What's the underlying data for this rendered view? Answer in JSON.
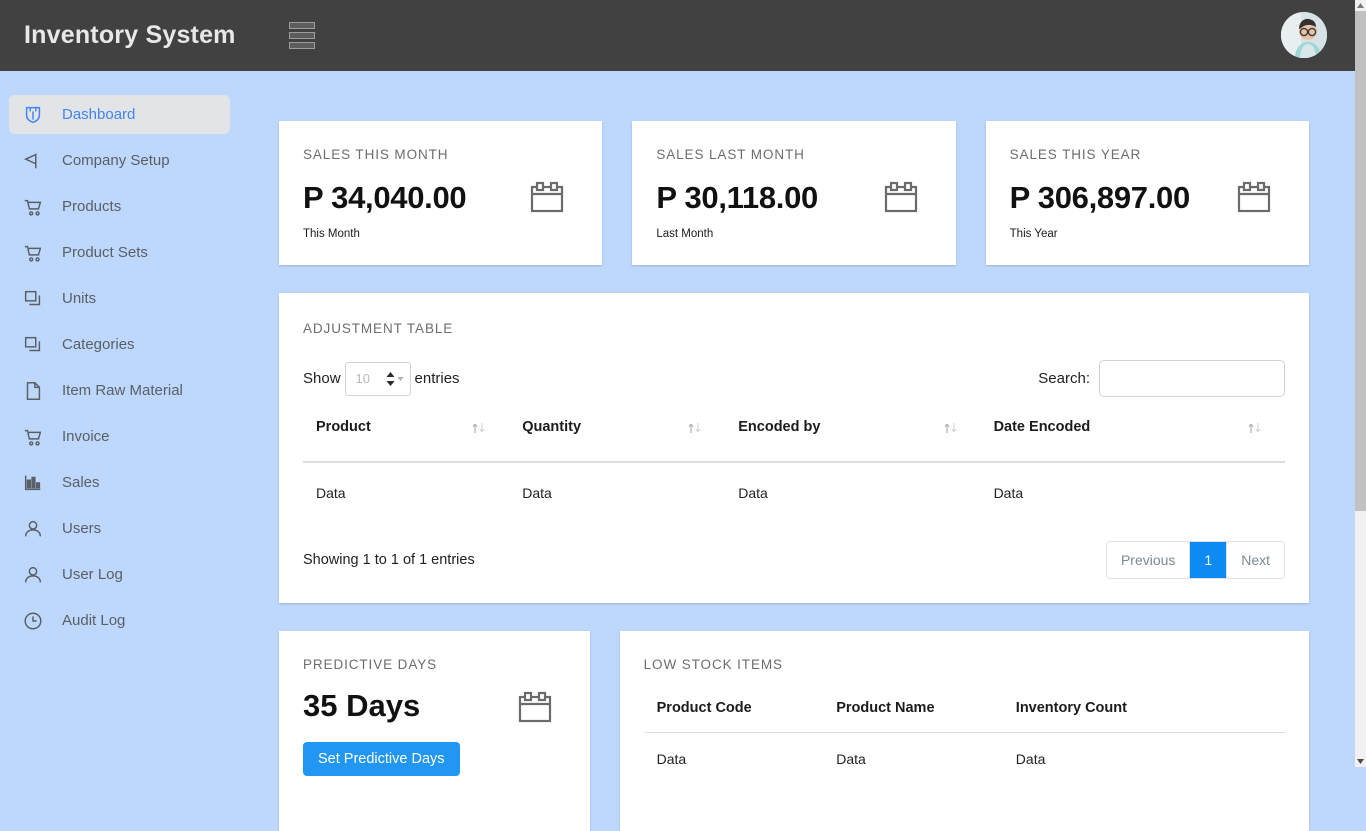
{
  "header": {
    "brand": "Inventory System",
    "menu_icon": "stacked-bars-menu-icon",
    "avatar_icon": "user-avatar"
  },
  "sidebar": {
    "items": [
      {
        "label": "Dashboard",
        "icon": "shield-icon",
        "active": true
      },
      {
        "label": "Company Setup",
        "icon": "flag-icon",
        "active": false
      },
      {
        "label": "Products",
        "icon": "shopping-cart-icon",
        "active": false
      },
      {
        "label": "Product Sets",
        "icon": "shopping-cart-icon",
        "active": false
      },
      {
        "label": "Units",
        "icon": "copy-icon",
        "active": false
      },
      {
        "label": "Categories",
        "icon": "copy-icon",
        "active": false
      },
      {
        "label": "Item Raw Material",
        "icon": "file-icon",
        "active": false
      },
      {
        "label": "Invoice",
        "icon": "shopping-cart-icon",
        "active": false
      },
      {
        "label": "Sales",
        "icon": "bar-chart-icon",
        "active": false
      },
      {
        "label": "Users",
        "icon": "user-icon",
        "active": false
      },
      {
        "label": "User Log",
        "icon": "user-icon",
        "active": false
      },
      {
        "label": "Audit Log",
        "icon": "clock-icon",
        "active": false
      }
    ]
  },
  "stats": [
    {
      "title": "SALES THIS MONTH",
      "value": "P 34,040.00",
      "sub": "This Month",
      "icon": "calendar-icon"
    },
    {
      "title": "SALES LAST MONTH",
      "value": "P 30,118.00",
      "sub": "Last Month",
      "icon": "calendar-icon"
    },
    {
      "title": "SALES THIS YEAR",
      "value": "P 306,897.00",
      "sub": "This Year",
      "icon": "calendar-icon"
    }
  ],
  "adjustment_table": {
    "title": "ADJUSTMENT TABLE",
    "show_label": "Show",
    "entries_label": "entries",
    "page_length": "10",
    "search_label": "Search:",
    "search_value": "",
    "search_placeholder": "",
    "columns": [
      "Product",
      "Quantity",
      "Encoded by",
      "Date Encoded"
    ],
    "rows": [
      [
        "Data",
        "Data",
        "Data",
        "Data"
      ]
    ],
    "info": "Showing 1 to 1 of 1 entries",
    "pagination": {
      "previous": "Previous",
      "pages": [
        "1"
      ],
      "current": "1",
      "next": "Next"
    }
  },
  "predictive": {
    "title": "PREDICTIVE DAYS",
    "value": "35 Days",
    "button": "Set Predictive Days",
    "icon": "calendar-icon"
  },
  "low_stock": {
    "title": "LOW STOCK ITEMS",
    "columns": [
      "Product Code",
      "Product Name",
      "Inventory Count"
    ],
    "rows": [
      [
        "Data",
        "Data",
        "Data"
      ]
    ]
  },
  "colors": {
    "accent_blue": "#2196f3",
    "pager_active": "#0d8bf2",
    "topbar": "#414141",
    "page_background": "#bed8fd",
    "active_nav_text": "#4285f4"
  }
}
